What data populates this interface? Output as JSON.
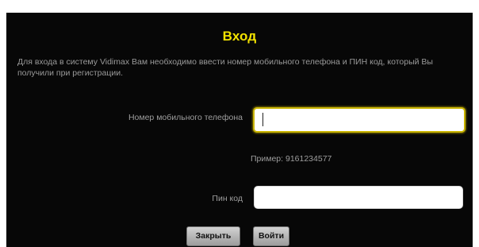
{
  "dialog": {
    "title": "Вход",
    "description": "Для входа в систему Vidimax Вам необходимо ввести номер мобильного телефона и ПИН код, который Вы получили при регистрации.",
    "phone_label": "Номер мобильного телефона",
    "phone_value": "",
    "example_text": "Пример: 9161234577",
    "pin_label": "Пин код",
    "pin_value": "",
    "close_button": "Закрыть",
    "login_button": "Войти"
  },
  "colors": {
    "background": "#070707",
    "title": "#f2e200",
    "focus_border": "#c9b400",
    "text_muted": "#9e9e9e"
  }
}
